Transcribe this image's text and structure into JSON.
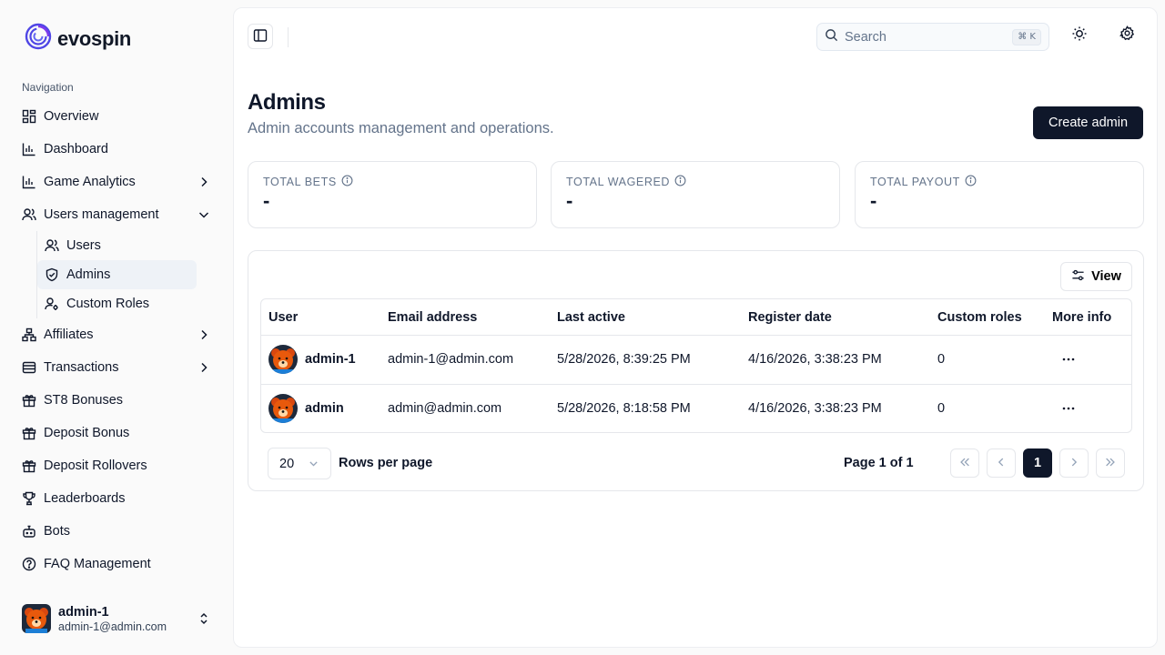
{
  "brand": {
    "name": "evospin",
    "color": "#4f46e5"
  },
  "sidebar": {
    "heading": "Navigation",
    "items": [
      {
        "label": "Overview",
        "icon": "grid-icon"
      },
      {
        "label": "Dashboard",
        "icon": "bar-chart-icon"
      },
      {
        "label": "Game Analytics",
        "icon": "bar-chart-icon",
        "chevron": "right"
      },
      {
        "label": "Users management",
        "icon": "users-icon",
        "chevron": "down"
      },
      {
        "label": "Affiliates",
        "icon": "network-icon",
        "chevron": "right"
      },
      {
        "label": "Transactions",
        "icon": "wallet-icon",
        "chevron": "right"
      },
      {
        "label": "ST8 Bonuses",
        "icon": "gift-icon"
      },
      {
        "label": "Deposit Bonus",
        "icon": "gift-icon"
      },
      {
        "label": "Deposit Rollovers",
        "icon": "gift-icon"
      },
      {
        "label": "Leaderboards",
        "icon": "trophy-icon"
      },
      {
        "label": "Bots",
        "icon": "bot-icon"
      },
      {
        "label": "FAQ Management",
        "icon": "help-circle-icon"
      }
    ],
    "subitems": [
      {
        "label": "Users",
        "icon": "users-icon"
      },
      {
        "label": "Admins",
        "icon": "shield-check-icon",
        "active": true
      },
      {
        "label": "Custom Roles",
        "icon": "user-cog-icon"
      }
    ],
    "user": {
      "name": "admin-1",
      "email": "admin-1@admin.com"
    }
  },
  "topbar": {
    "search_placeholder": "Search",
    "shortcut": "⌘ K"
  },
  "page": {
    "title": "Admins",
    "subtitle": "Admin accounts management and operations.",
    "create_label": "Create admin"
  },
  "stats": [
    {
      "label": "TOTAL BETS",
      "value": "-"
    },
    {
      "label": "TOTAL WAGERED",
      "value": "-"
    },
    {
      "label": "TOTAL PAYOUT",
      "value": "-"
    }
  ],
  "table": {
    "view_label": "View",
    "columns": [
      "User",
      "Email address",
      "Last active",
      "Register date",
      "Custom roles",
      "More info"
    ],
    "rows": [
      {
        "user": "admin-1",
        "email": "admin-1@admin.com",
        "last_active": "5/28/2026, 8:39:25 PM",
        "register_date": "4/16/2026, 3:38:23 PM",
        "custom_roles": "0"
      },
      {
        "user": "admin",
        "email": "admin@admin.com",
        "last_active": "5/28/2026, 8:18:58 PM",
        "register_date": "4/16/2026, 3:38:23 PM",
        "custom_roles": "0"
      }
    ]
  },
  "pagination": {
    "rows_per_page_value": "20",
    "rows_per_page_label": "Rows per page",
    "page_info": "Page 1 of 1",
    "current_page": "1"
  }
}
